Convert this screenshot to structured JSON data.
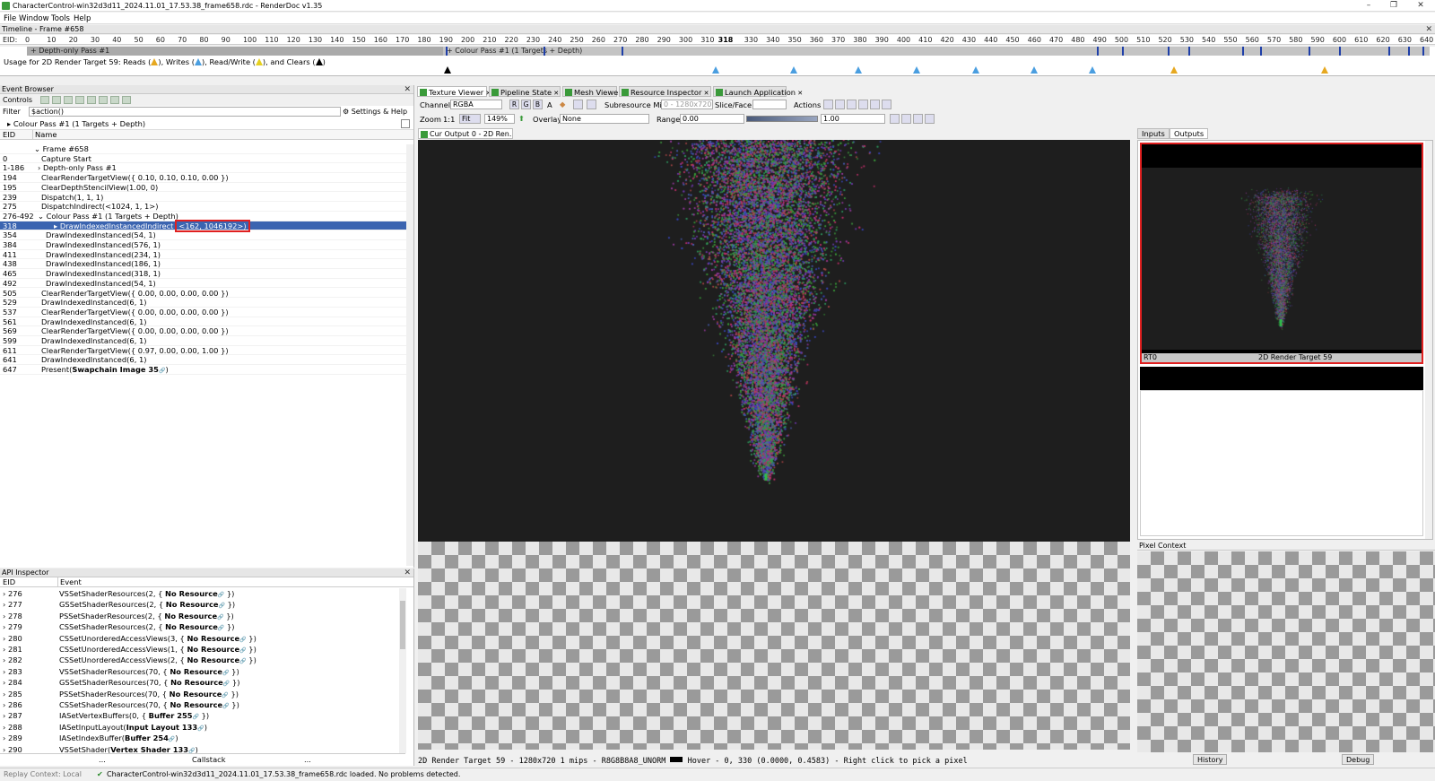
{
  "window": {
    "title": "CharacterControl-win32d3d11_2024.11.01_17.53.38_frame658.rdc - RenderDoc v1.35",
    "min_label": "–",
    "max_label": "❐",
    "close_label": "✕"
  },
  "menu": [
    "File",
    "Window",
    "Tools",
    "Help"
  ],
  "timeline": {
    "title": "Timeline - Frame #658",
    "eid_label": "EID:",
    "ticks": [
      "0",
      "10",
      "20",
      "30",
      "40",
      "50",
      "60",
      "70",
      "80",
      "90",
      "100",
      "110",
      "120",
      "130",
      "140",
      "150",
      "160",
      "170",
      "180",
      "190",
      "200",
      "210",
      "220",
      "230",
      "240",
      "250",
      "260",
      "270",
      "280",
      "290",
      "300",
      "310",
      "318",
      "330",
      "340",
      "350",
      "360",
      "370",
      "380",
      "390",
      "400",
      "410",
      "420",
      "430",
      "440",
      "450",
      "460",
      "470",
      "480",
      "490",
      "500",
      "510",
      "520",
      "530",
      "540",
      "550",
      "560",
      "570",
      "580",
      "590",
      "600",
      "610",
      "620",
      "630",
      "640"
    ],
    "pass1": "+ Depth-only Pass #1",
    "pass2": "+ Colour Pass #1 (1 Targets + Depth)",
    "usage_prefix": "Usage for 2D Render Target 59: Reads (",
    "usage_writes": "), Writes (",
    "usage_rw": "), Read/Write (",
    "usage_clears": "), and Clears (",
    "usage_end": ")"
  },
  "event_browser": {
    "title": "Event Browser",
    "controls_label": "Controls",
    "filter_label": "Filter",
    "filter_value": "$action()",
    "settings_label": "Settings & Help",
    "breadcrumb": "Colour Pass #1 (1 Targets + Depth)",
    "col_eid": "EID",
    "col_name": "Name",
    "rows": [
      {
        "eid": "",
        "name": "Frame #658"
      },
      {
        "eid": "0",
        "name": "Capture Start"
      },
      {
        "eid": "1-186",
        "name": "Depth-only Pass #1"
      },
      {
        "eid": "194",
        "name": "ClearRenderTargetView({ 0.10, 0.10, 0.10, 0.00 })"
      },
      {
        "eid": "195",
        "name": "ClearDepthStencilView(1.00, 0)"
      },
      {
        "eid": "239",
        "name": "Dispatch(1, 1, 1)"
      },
      {
        "eid": "275",
        "name": "DispatchIndirect(<1024, 1, 1>)"
      },
      {
        "eid": "276-492",
        "name": "Colour Pass #1 (1 Targets + Depth)"
      },
      {
        "eid": "318",
        "name": "DrawIndexedInstancedIndirect",
        "highlight": "<162, 1046192>)"
      },
      {
        "eid": "354",
        "name": "DrawIndexedInstanced(54, 1)"
      },
      {
        "eid": "384",
        "name": "DrawIndexedInstanced(576, 1)"
      },
      {
        "eid": "411",
        "name": "DrawIndexedInstanced(234, 1)"
      },
      {
        "eid": "438",
        "name": "DrawIndexedInstanced(186, 1)"
      },
      {
        "eid": "465",
        "name": "DrawIndexedInstanced(318, 1)"
      },
      {
        "eid": "492",
        "name": "DrawIndexedInstanced(54, 1)"
      },
      {
        "eid": "505",
        "name": "ClearRenderTargetView({ 0.00, 0.00, 0.00, 0.00 })"
      },
      {
        "eid": "529",
        "name": "DrawIndexedInstanced(6, 1)"
      },
      {
        "eid": "537",
        "name": "ClearRenderTargetView({ 0.00, 0.00, 0.00, 0.00 })"
      },
      {
        "eid": "561",
        "name": "DrawIndexedInstanced(6, 1)"
      },
      {
        "eid": "569",
        "name": "ClearRenderTargetView({ 0.00, 0.00, 0.00, 0.00 })"
      },
      {
        "eid": "599",
        "name": "DrawIndexedInstanced(6, 1)"
      },
      {
        "eid": "611",
        "name": "ClearRenderTargetView({ 0.97, 0.00, 0.00, 1.00 })"
      },
      {
        "eid": "641",
        "name": "DrawIndexedInstanced(6, 1)"
      },
      {
        "eid": "647",
        "name": "Present(",
        "bold": "Swapchain Image 35",
        "end": ")"
      }
    ]
  },
  "api_inspector": {
    "title": "API Inspector",
    "col_eid": "EID",
    "col_event": "Event",
    "rows": [
      {
        "eid": "276",
        "pre": "VSSetShaderResources(2, { ",
        "bold": "No Resource",
        "post": " })"
      },
      {
        "eid": "277",
        "pre": "GSSetShaderResources(2, { ",
        "bold": "No Resource",
        "post": " })"
      },
      {
        "eid": "278",
        "pre": "PSSetShaderResources(2, { ",
        "bold": "No Resource",
        "post": " })"
      },
      {
        "eid": "279",
        "pre": "CSSetShaderResources(2, { ",
        "bold": "No Resource",
        "post": " })"
      },
      {
        "eid": "280",
        "pre": "CSSetUnorderedAccessViews(3, { ",
        "bold": "No Resource",
        "post": " })"
      },
      {
        "eid": "281",
        "pre": "CSSetUnorderedAccessViews(1, { ",
        "bold": "No Resource",
        "post": " })"
      },
      {
        "eid": "282",
        "pre": "CSSetUnorderedAccessViews(2, { ",
        "bold": "No Resource",
        "post": " })"
      },
      {
        "eid": "283",
        "pre": "VSSetShaderResources(70, { ",
        "bold": "No Resource",
        "post": " })"
      },
      {
        "eid": "284",
        "pre": "GSSetShaderResources(70, { ",
        "bold": "No Resource",
        "post": " })"
      },
      {
        "eid": "285",
        "pre": "PSSetShaderResources(70, { ",
        "bold": "No Resource",
        "post": " })"
      },
      {
        "eid": "286",
        "pre": "CSSetShaderResources(70, { ",
        "bold": "No Resource",
        "post": " })"
      },
      {
        "eid": "287",
        "pre": "IASetVertexBuffers(0, { ",
        "bold": "Buffer 255",
        "post": " })"
      },
      {
        "eid": "288",
        "pre": "IASetInputLayout(",
        "bold": "Input Layout 133",
        "post": ")"
      },
      {
        "eid": "289",
        "pre": "IASetIndexBuffer(",
        "bold": "Buffer 254",
        "post": ")"
      },
      {
        "eid": "290",
        "pre": "VSSetShader(",
        "bold": "Vertex Shader 133",
        "post": ")"
      }
    ],
    "callstack_label": "Callstack",
    "dots": "..."
  },
  "tabs": [
    "Texture Viewer",
    "Pipeline State",
    "Mesh Viewer",
    "Resource Inspector",
    "Launch Application"
  ],
  "texture_viewer": {
    "channels_label": "Channels",
    "channels_value": "RGBA",
    "ch_r": "R",
    "ch_g": "G",
    "ch_b": "B",
    "ch_a": "A",
    "subresource_label": "Subresource",
    "mip_label": "Mip",
    "mip_value": "0 - 1280x720",
    "slice_label": "Slice/Face",
    "actions_label": "Actions",
    "zoom_label": "Zoom",
    "zoom_1to1": "1:1",
    "fit_label": "Fit",
    "zoom_value": "149%",
    "overlay_label": "Overlay",
    "overlay_value": "None",
    "range_label": "Range",
    "range_min": "0.00",
    "range_max": "1.00",
    "output_tab": "Cur Output 0 - 2D Ren..."
  },
  "side_panel": {
    "tab_inputs": "Inputs",
    "tab_outputs": "Outputs",
    "rt_label": "RT0",
    "rt_name": "2D Render Target 59",
    "pixel_context_title": "Pixel Context",
    "history_label": "History",
    "debug_label": "Debug"
  },
  "texture_status": "2D Render Target 59 - 1280x720 1 mips - R8G8B8A8_UNORM",
  "hover_status": "Hover -     0,  330 (0.0000, 0.4583) - Right click to pick a pixel",
  "statusbar": {
    "replay": "Replay Context: Local",
    "message": "CharacterControl-win32d3d11_2024.11.01_17.53.38_frame658.rdc loaded. No problems detected."
  },
  "colors": {
    "selection": "#3b64b0",
    "highlight_border": "#e02020",
    "viewport_bg": "#1e1e1e",
    "event_marker": "#1f3fa8"
  }
}
